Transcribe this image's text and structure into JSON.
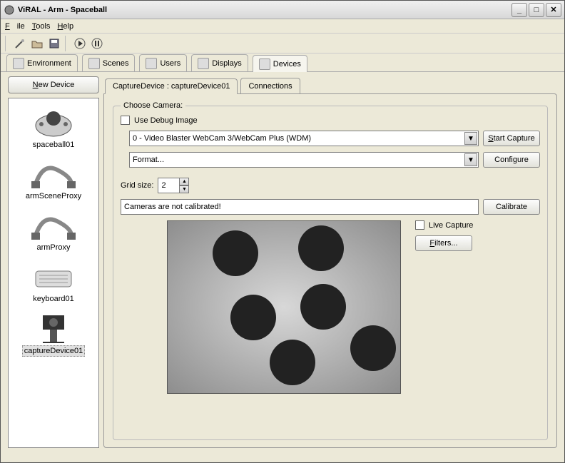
{
  "window": {
    "title": "ViRAL - Arm - Spaceball"
  },
  "menubar": {
    "file": "File",
    "tools": "Tools",
    "help": "Help"
  },
  "tabs": {
    "environment": "Environment",
    "scenes": "Scenes",
    "users": "Users",
    "displays": "Displays",
    "devices": "Devices"
  },
  "sidebar": {
    "new_device": "New Device",
    "items": [
      {
        "label": "spaceball01"
      },
      {
        "label": "armSceneProxy"
      },
      {
        "label": "armProxy"
      },
      {
        "label": "keyboard01"
      },
      {
        "label": "captureDevice01"
      }
    ]
  },
  "subtabs": {
    "capture_device": "CaptureDevice : captureDevice01",
    "connections": "Connections"
  },
  "panel": {
    "legend": "Choose Camera:",
    "use_debug_image": "Use Debug Image",
    "camera_select": "0 - Video Blaster WebCam 3/WebCam Plus (WDM)",
    "start_capture": "Start Capture",
    "format_select": "Format...",
    "configure": "Configure",
    "grid_size_label": "Grid size:",
    "grid_size_value": "2",
    "status": "Cameras are not calibrated!",
    "calibrate": "Calibrate",
    "live_capture": "Live Capture",
    "filters": "Filters..."
  }
}
